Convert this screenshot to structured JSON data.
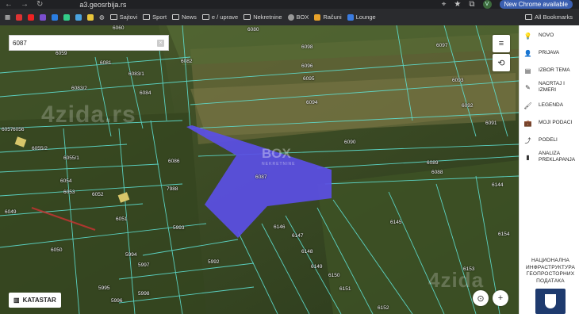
{
  "browser": {
    "url": "a3.geosrbija.rs",
    "profile_initial": "V",
    "update_label": "New Chrome available",
    "bookmarks": [
      "Sajtovi",
      "Sport",
      "News",
      "e / uprave",
      "Nekretnine",
      "BOX",
      "Računi",
      "Lounge"
    ],
    "all_bookmarks": "All Bookmarks"
  },
  "search": {
    "value": "6087"
  },
  "map_buttons": {
    "katastar": "KATASTAR"
  },
  "watermarks": {
    "site": "4zida.rs",
    "site2": "4zida",
    "box": "BOX",
    "box_sub": "NEKRETNINE"
  },
  "parcels": [
    "6060",
    "6080",
    "6059",
    "6081",
    "6098",
    "6097",
    "6082",
    "6096",
    "6083/1",
    "6095",
    "6093",
    "6083/2",
    "6084",
    "6094",
    "6092",
    "6057",
    "6056",
    "6091",
    "6090",
    "6055/2",
    "6086",
    "6089",
    "6055/1",
    "6088",
    "6054",
    "6087",
    "6144",
    "6053",
    "7988",
    "6052",
    "6049",
    "6051",
    "6146",
    "6145",
    "5993",
    "6147",
    "6154",
    "6050",
    "5994",
    "6148",
    "5997",
    "5992",
    "6153",
    "6149",
    "6150",
    "5995",
    "5998",
    "6151",
    "5996",
    "6152"
  ],
  "sidebar": {
    "items": [
      {
        "label": "NOVO",
        "icon": "lightbulb-icon"
      },
      {
        "label": "PRIJAVA",
        "icon": "user-icon"
      },
      {
        "label": "IZBOR TEMA",
        "icon": "layers-icon"
      },
      {
        "label": "NACRTAJ I IZMERI",
        "icon": "pencil-icon"
      },
      {
        "label": "LEGENDA",
        "icon": "brush-icon"
      },
      {
        "label": "MOJI PODACI",
        "icon": "briefcase-icon"
      },
      {
        "label": "PODELI",
        "icon": "share-icon"
      },
      {
        "label": "ANALIZA PREKLAPANJA",
        "icon": "document-icon"
      }
    ],
    "agency": "НАЦИОНАЛНА ИНФРАСТРУКТУРА ГЕОПРОСТОРНИХ ПОДАТАКА"
  },
  "colors": {
    "highlight": "#5b4fe6",
    "parcel_line": "#5fe0d2",
    "sidebar_bg": "#ffffff"
  }
}
